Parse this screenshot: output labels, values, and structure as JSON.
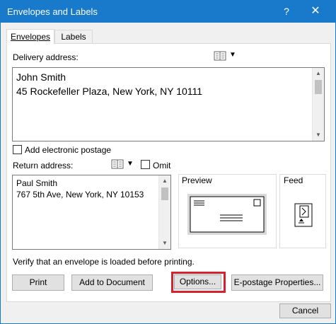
{
  "window": {
    "title": "Envelopes and Labels",
    "help": "?",
    "close": "✕"
  },
  "tabs": [
    {
      "label": "Envelopes",
      "active": true
    },
    {
      "label": "Labels",
      "active": false
    }
  ],
  "delivery": {
    "label": "Delivery address:",
    "text": "John Smith\n45 Rockefeller Plaza, New York, NY 10111"
  },
  "postage": {
    "label": "Add electronic postage",
    "checked": false
  },
  "return": {
    "label": "Return address:",
    "omit_label": "Omit",
    "omit_checked": false,
    "text": "Paul Smith\n767 5th Ave, New York, NY 10153"
  },
  "preview": {
    "label": "Preview"
  },
  "feed": {
    "label": "Feed"
  },
  "verify_text": "Verify that an envelope is loaded before printing.",
  "buttons": {
    "print": "Print",
    "add_to_document": "Add to Document",
    "options": "Options...",
    "epostage": "E-postage Properties...",
    "cancel": "Cancel"
  },
  "icons": {
    "address_book": "address-book-icon",
    "dropdown": "chevron-down-icon",
    "envelope_preview": "envelope-preview-icon",
    "feed": "envelope-feed-icon"
  },
  "colors": {
    "titlebar": "#1979ca",
    "highlight": "#d6212f"
  }
}
